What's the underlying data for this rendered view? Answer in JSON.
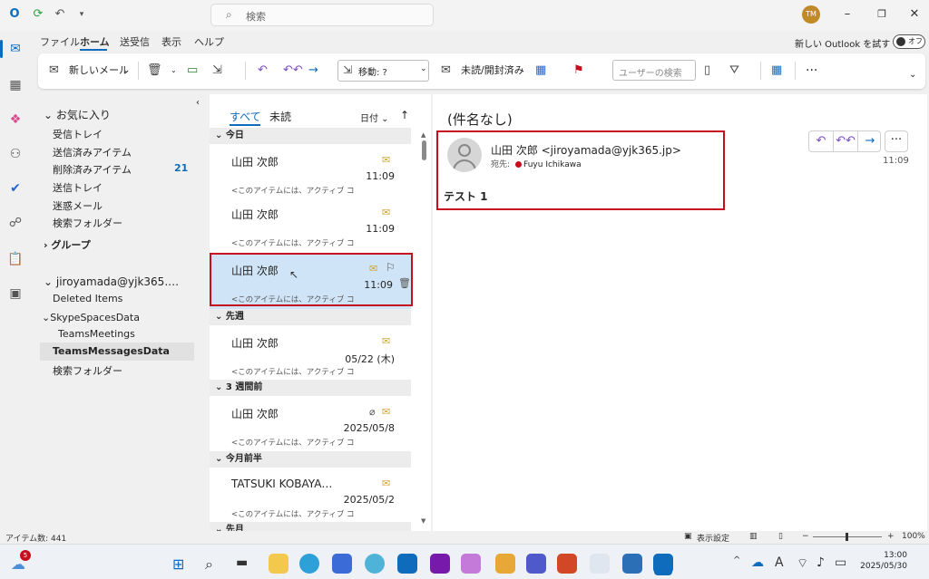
{
  "titlebar": {
    "search_placeholder": "検索",
    "user_initials": "TM"
  },
  "menu": {
    "tabs": [
      "ファイル",
      "ホーム",
      "送受信",
      "表示",
      "ヘルプ"
    ],
    "active_tab": "ホーム",
    "new_outlook_label": "新しい Outlook を試す",
    "toggle_label": "オフ"
  },
  "ribbon": {
    "new_mail": "新しいメール",
    "move_to": "移動: ?",
    "unread_read": "未読/開封済み",
    "user_search_placeholder": "ユーザーの検索"
  },
  "folders": {
    "favorites_header": "お気に入り",
    "favorites": [
      "受信トレイ",
      "送信済みアイテム",
      "削除済みアイテム"
    ],
    "deleted_count": "21",
    "others": [
      "送信トレイ",
      "迷惑メール",
      "検索フォルダー"
    ],
    "groups_header": "グループ",
    "account_header": "jiroyamada@yjk365.…",
    "account_items": [
      "Deleted Items",
      "SkypeSpacesData",
      "TeamsMeetings",
      "TeamsMessagesData",
      "検索フォルダー"
    ],
    "selected": "TeamsMessagesData"
  },
  "message_list": {
    "tab_all": "すべて",
    "tab_unread": "未読",
    "sort_label": "日付",
    "groups": [
      "今日",
      "先週",
      "3 週間前",
      "今月前半",
      "先月"
    ],
    "messages": [
      {
        "from": "山田 次郎",
        "time": "11:09",
        "preview": "<このアイテムには、アクティブ コ"
      },
      {
        "from": "山田 次郎",
        "time": "11:09",
        "preview": "<このアイテムには、アクティブ コ"
      },
      {
        "from": "山田 次郎",
        "time": "11:09",
        "preview": "<このアイテムには、アクティブ コ"
      },
      {
        "from": "山田 次郎",
        "time": "05/22 (木)",
        "preview": "<このアイテムには、アクティブ コ"
      },
      {
        "from": "山田 次郎",
        "time": "2025/05/8",
        "preview": "<このアイテムには、アクティブ コ"
      },
      {
        "from": "TATSUKI KOBAYA…",
        "time": "2025/05/2",
        "preview": "<このアイテムには、アクティブ コ"
      }
    ]
  },
  "reading": {
    "subject": "(件名なし)",
    "from": "山田 次郎 <jiroyamada@yjk365.jp>",
    "to_label": "宛先:",
    "to": "Fuyu Ichikawa",
    "time": "11:09",
    "body": "テスト 1"
  },
  "statusbar": {
    "item_count": "アイテム数: 441",
    "display_settings": "表示設定",
    "zoom": "100%"
  },
  "taskbar": {
    "weather_badge": "5",
    "time": "13:00",
    "date": "2025/05/30"
  },
  "colors": {
    "accent": "#0f6cbd",
    "highlight_box": "#c50f1f",
    "selected_row": "#cfe4f7"
  }
}
